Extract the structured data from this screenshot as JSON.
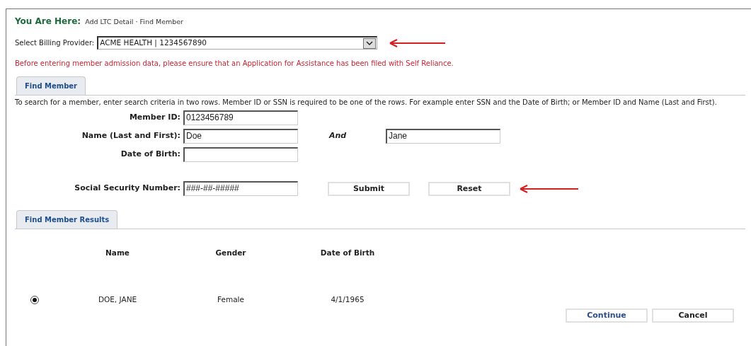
{
  "breadcrumb": {
    "label": "You Are Here:",
    "path": "Add LTC Detail · Find Member"
  },
  "billing_provider": {
    "label": "Select Billing Provider:",
    "value": "ACME HEALTH | 1234567890",
    "arrow": true
  },
  "notice": "Before entering member admission data, please ensure that an Application for Assistance has been filed with Self Reliance.",
  "search_tab": {
    "label": "Find Member",
    "selected": true
  },
  "instructions": "To search for a member, enter search criteria in two rows. Member ID or SSN is required to be one of the rows. For example enter SSN and the Date of Birth; or Member ID and Name (Last and First).",
  "member_id": {
    "label": "Member ID:",
    "value": "0123456789"
  },
  "name": {
    "label": "Name (Last and First):",
    "last": "Doe",
    "conjunction": "And",
    "first": "Jane"
  },
  "date_of_birth": {
    "label": "Date of Birth:"
  },
  "ssn": {
    "label": "Social Security Number:",
    "value": "###-##-#####"
  },
  "search_buttons": {
    "items": [
      "Submit",
      "Reset"
    ],
    "arrow": true
  },
  "results_tab": {
    "label": "Find Member Results",
    "selected": true
  },
  "results": {
    "columns": [
      "Name",
      "Gender",
      "Date of Birth"
    ],
    "rows": [
      {
        "selected": true,
        "cells": [
          "DOE, JANE",
          "Female",
          "4/1/1965"
        ]
      }
    ]
  },
  "footer_buttons": [
    "Continue",
    "Cancel"
  ]
}
